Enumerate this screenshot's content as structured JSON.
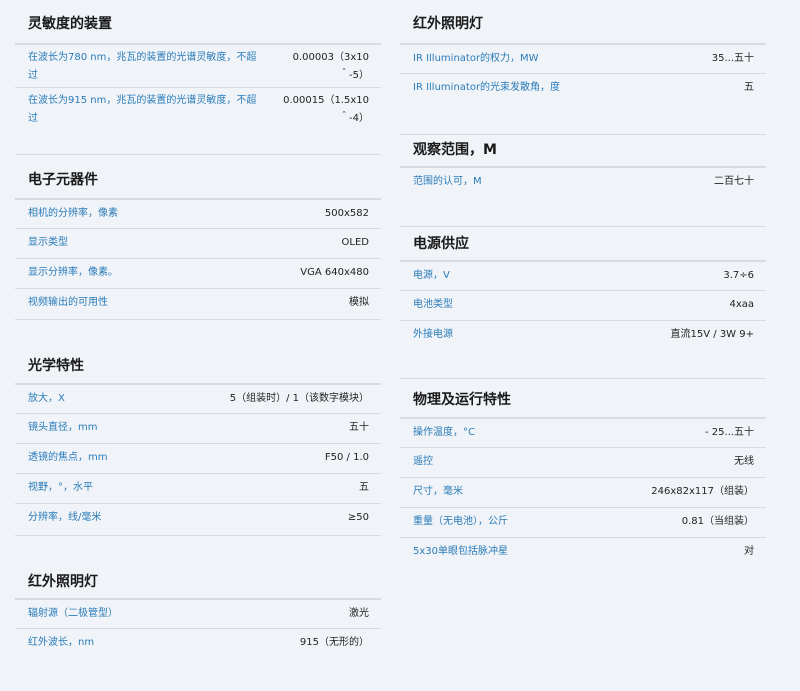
{
  "left": {
    "sensitivity": {
      "title": "灵敏度的装置",
      "rows": [
        {
          "label": "在波长为780 nm，兆瓦的装置的光谱灵敏度，不超过",
          "value": "0.00003（3x10＾-5）"
        },
        {
          "label": "在波长为915 nm，兆瓦的装置的光谱灵敏度，不超过",
          "value": "0.00015（1.5x10＾-4）"
        }
      ]
    },
    "electronics": {
      "title": "电子元器件",
      "rows": [
        {
          "label": "相机的分辨率，像素",
          "value": "500x582"
        },
        {
          "label": "显示类型",
          "value": "OLED"
        },
        {
          "label": "显示分辨率，像素。",
          "value": "VGA 640x480"
        },
        {
          "label": "视频输出的可用性",
          "value": "模拟"
        }
      ]
    },
    "optics": {
      "title": "光学特性",
      "rows": [
        {
          "label": "放大，X",
          "value": "5（组装时）/ 1（该数字模块）"
        },
        {
          "label": "镜头直径，mm",
          "value": "五十"
        },
        {
          "label": "透镜的焦点，mm",
          "value": "F50 / 1.0"
        },
        {
          "label": "视野，°，水平",
          "value": "五"
        },
        {
          "label": "分辨率，线/毫米",
          "value": "≥50"
        }
      ]
    },
    "ir_light": {
      "title": "红外照明灯",
      "rows": [
        {
          "label": "辐射源（二极管型）",
          "value": "激光"
        },
        {
          "label": "红外波长，nm",
          "value": "915（无形的）"
        }
      ]
    }
  },
  "right": {
    "ir_illuminator": {
      "title": "红外照明灯",
      "rows": [
        {
          "label": "IR Illuminator的权力，MW",
          "value": "35...五十"
        },
        {
          "label": "IR Illuminator的光束发散角，度",
          "value": "五"
        }
      ]
    },
    "range": {
      "title": "观察范围，M",
      "rows": [
        {
          "label": "范围的认可，M",
          "value": "二百七十"
        }
      ]
    },
    "power": {
      "title": "电源供应",
      "rows": [
        {
          "label": "电源，V",
          "value": "3.7÷6"
        },
        {
          "label": "电池类型",
          "value": "4xaa"
        },
        {
          "label": "外接电源",
          "value": "直流15V / 3W 9+"
        }
      ]
    },
    "physical": {
      "title": "物理及运行特性",
      "rows": [
        {
          "label": "操作温度，°C",
          "value": "- 25...五十"
        },
        {
          "label": "遥控",
          "value": "无线"
        },
        {
          "label": "尺寸，毫米",
          "value": "246x82x117（组装）"
        },
        {
          "label": "重量（无电池），公斤",
          "value": "0.81（当组装）"
        },
        {
          "label": "5x30单眼包括脉冲星",
          "value": "对"
        }
      ]
    }
  }
}
